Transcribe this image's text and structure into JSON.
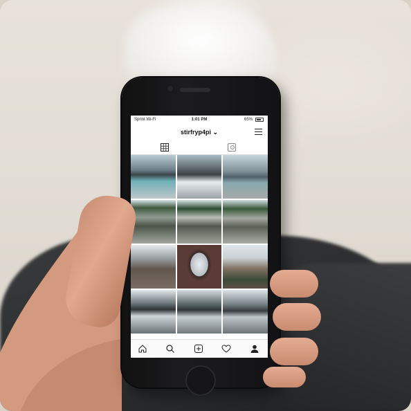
{
  "phone_screen": {
    "status_bar": {
      "carrier": "Sprint Wi-Fi",
      "time": "1:01 PM",
      "battery": "65%"
    },
    "profile": {
      "username": "stirfryp4pi"
    },
    "icons": {
      "menu": "hamburger-menu-icon",
      "grid_tab": "grid-icon",
      "tagged_tab": "tagged-icon",
      "nav": [
        "home-icon",
        "search-icon",
        "add-post-icon",
        "heart-icon",
        "profile-icon"
      ]
    },
    "accent_color": "#111111"
  }
}
